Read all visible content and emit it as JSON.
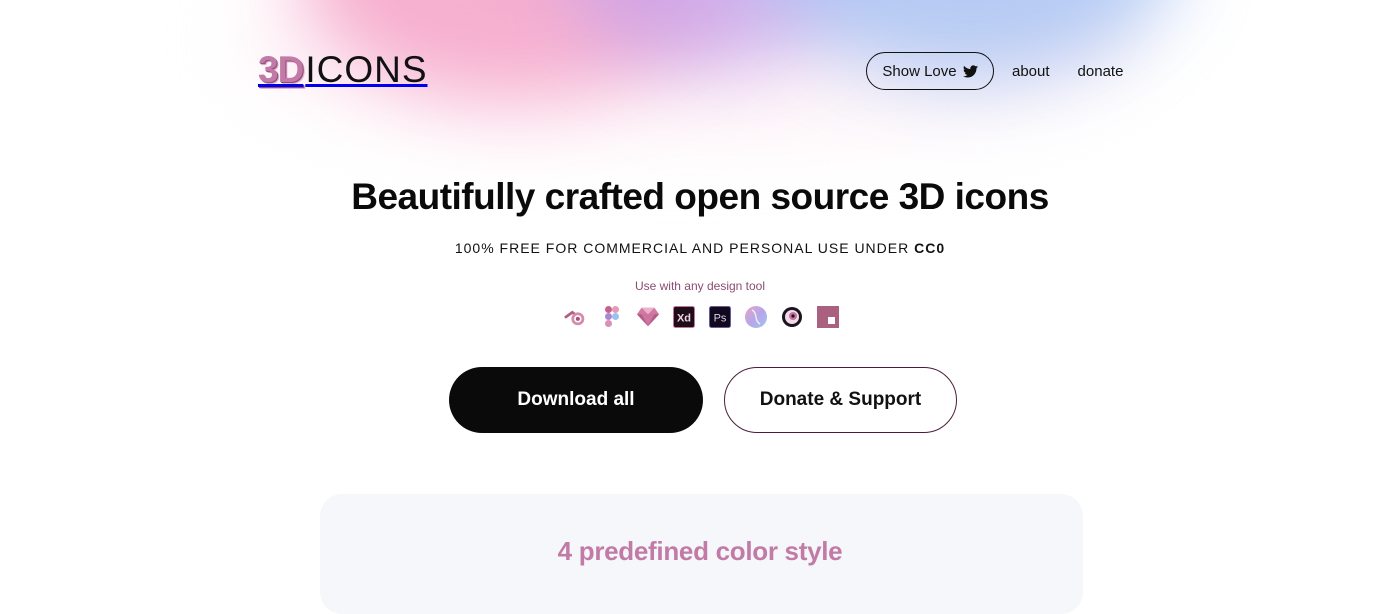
{
  "brand": {
    "logo_3d": "3D",
    "logo_word": "ICONS"
  },
  "nav": {
    "show_love_label": "Show Love",
    "about_label": "about",
    "donate_label": "donate"
  },
  "hero": {
    "title": "Beautifully crafted open source 3D icons",
    "subtitle_main": "100% FREE FOR COMMERCIAL AND PERSONAL USE UNDER ",
    "subtitle_license": "CC0",
    "tools_label": "Use with any design tool",
    "tools": [
      {
        "name": "blender-icon"
      },
      {
        "name": "figma-icon"
      },
      {
        "name": "sketch-icon"
      },
      {
        "name": "adobe-xd-icon",
        "text": "Xd"
      },
      {
        "name": "photoshop-icon",
        "text": "Ps"
      },
      {
        "name": "spline-icon"
      },
      {
        "name": "cinema4d-icon"
      },
      {
        "name": "keynote-icon"
      }
    ]
  },
  "cta": {
    "primary_label": "Download all",
    "secondary_label": "Donate & Support"
  },
  "section": {
    "title": "4 predefined color style"
  },
  "colors": {
    "accent_pink": "#c27ba6",
    "text_dark": "#0a0a0a",
    "muted_purple": "#8a4c74"
  }
}
